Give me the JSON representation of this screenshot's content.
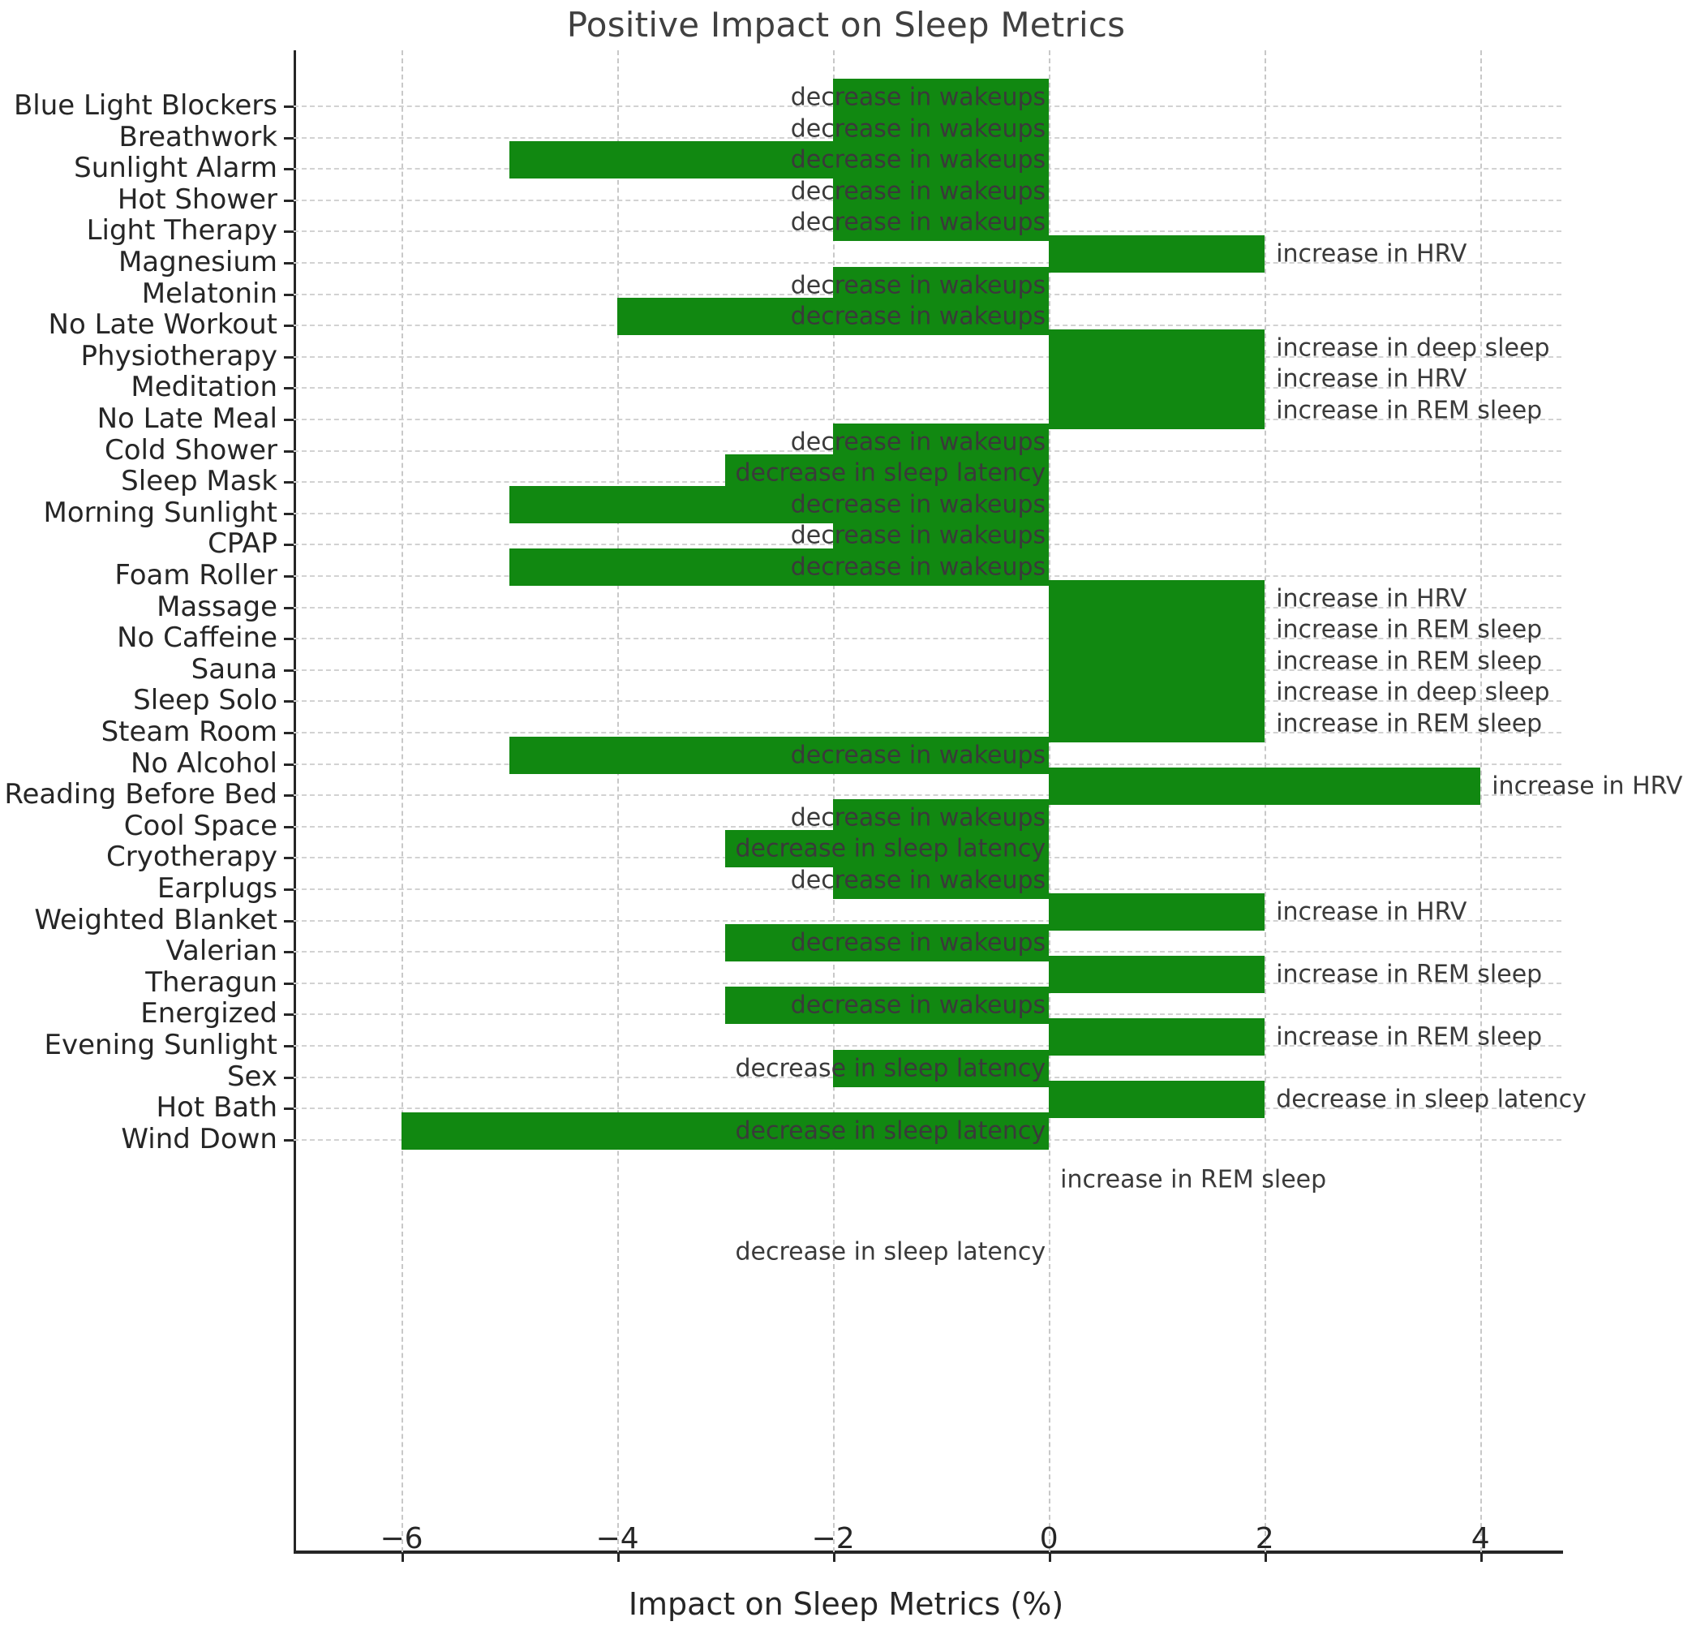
{
  "chart_data": {
    "type": "bar",
    "orientation": "horizontal",
    "title": "Positive Impact on Sleep Metrics",
    "xlabel": "Impact on Sleep Metrics (%)",
    "ylabel": "",
    "xlim": [
      -7.0,
      4.75
    ],
    "ylim_note": "categorical",
    "xticks": [
      -6,
      -4,
      -2,
      0,
      2,
      4
    ],
    "xticklabels": [
      "−6",
      "−4",
      "−2",
      "0",
      "2",
      "4"
    ],
    "grid": true,
    "bar_color": "#118811",
    "categories": [
      "Blue Light Blockers",
      "Breathwork",
      "Sunlight Alarm",
      "Hot Shower",
      "Light Therapy",
      "Magnesium",
      "Melatonin",
      "No Late Workout",
      "Physiotherapy",
      "Meditation",
      "No Late Meal",
      "Cold Shower",
      "Sleep Mask",
      "Morning Sunlight",
      "CPAP",
      "Foam Roller",
      "Massage",
      "No Caffeine",
      "Sauna",
      "Sleep Solo",
      "Steam Room",
      "No Alcohol",
      "Reading Before Bed",
      "Cool Space",
      "Cryotherapy",
      "Earplugs",
      "Weighted Blanket",
      "Valerian",
      "Theragun",
      "Energized",
      "Evening Sunlight",
      "Sex",
      "Hot Bath",
      "Wind Down"
    ],
    "values": [
      -2,
      -2,
      -5,
      -2,
      -2,
      2,
      -2,
      -4,
      2,
      2,
      2,
      -2,
      -3,
      -5,
      -2,
      -5,
      2,
      2,
      2,
      2,
      2,
      -5,
      4,
      -2,
      -3,
      -2,
      2,
      -3,
      2,
      -3,
      2,
      -2,
      2,
      -6
    ],
    "metric_labels": [
      "decrease in wakeups",
      "decrease in wakeups",
      "decrease in wakeups",
      "decrease in wakeups",
      "decrease in wakeups",
      "increase in HRV",
      "decrease in wakeups",
      "decrease in wakeups",
      "increase in deep sleep",
      "increase in HRV",
      "increase in REM sleep",
      "decrease in wakeups",
      "decrease in sleep latency",
      "decrease in wakeups",
      "decrease in wakeups",
      "decrease in wakeups",
      "increase in HRV",
      "increase in REM sleep",
      "increase in REM sleep",
      "increase in deep sleep",
      "increase in REM sleep",
      "decrease in wakeups",
      "increase in HRV",
      "decrease in wakeups",
      "decrease in sleep latency",
      "decrease in wakeups",
      "increase in HRV",
      "decrease in wakeups",
      "increase in REM sleep",
      "decrease in wakeups",
      "increase in REM sleep",
      "decrease in sleep latency",
      "decrease in sleep latency",
      "decrease in sleep latency"
    ],
    "trailing_labels": [
      "increase in REM sleep",
      "decrease in sleep latency"
    ]
  }
}
